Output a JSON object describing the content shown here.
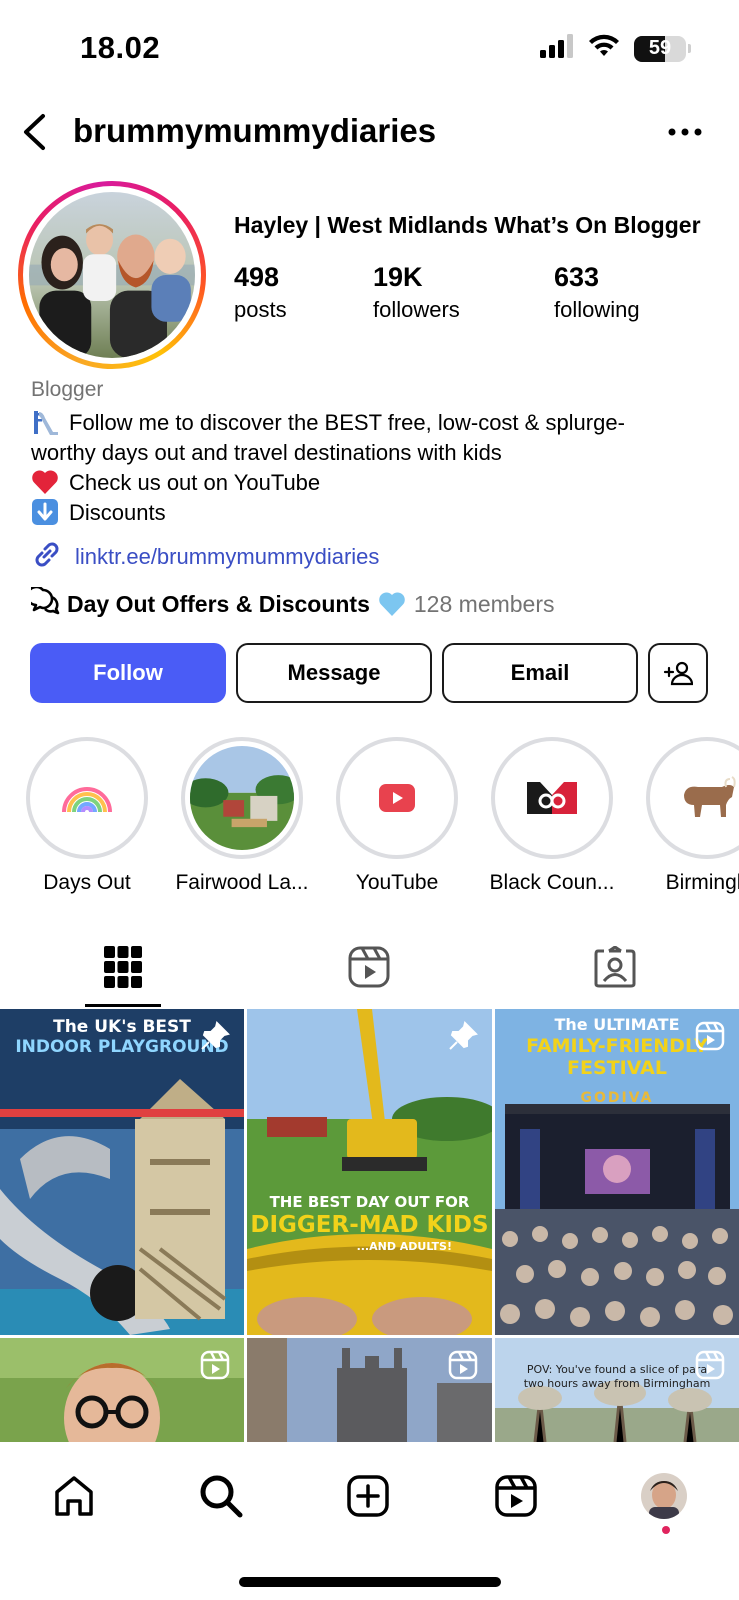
{
  "status_bar": {
    "time": "18.02",
    "battery": "59",
    "battery_level": 0.59
  },
  "profile": {
    "username": "brummymummydiaries",
    "display_name": "Hayley | West Midlands What’s On Blogger",
    "stats": [
      {
        "value": "498",
        "label": "posts"
      },
      {
        "value": "19K",
        "label": "followers"
      },
      {
        "value": "633",
        "label": "following"
      }
    ],
    "category": "Blogger",
    "bio": {
      "line1": "Follow me to discover the BEST free, low-cost & splurge-",
      "line1b": "worthy days out and travel destinations with kids",
      "line2": "Check us out on YouTube",
      "line3": "Discounts",
      "line3_emoji": "⬇️"
    },
    "link": "linktr.ee/brummymummydiaries",
    "community": {
      "name": "Day Out Offers & Discounts",
      "members": "128 members"
    }
  },
  "actions": {
    "follow": "Follow",
    "message": "Message",
    "email": "Email"
  },
  "highlights": [
    {
      "label": "Days Out",
      "icon": "rainbow-icon"
    },
    {
      "label": "Fairwood La...",
      "icon": "park-photo"
    },
    {
      "label": "YouTube",
      "icon": "youtube-icon"
    },
    {
      "label": "Black Coun...",
      "icon": "black-country-flag-icon"
    },
    {
      "label": "Birmingh",
      "icon": "bull-icon"
    }
  ],
  "tabs": [
    {
      "name": "posts-grid",
      "icon": "grid-icon",
      "active": true
    },
    {
      "name": "reels",
      "icon": "reels-icon",
      "active": false
    },
    {
      "name": "tagged",
      "icon": "tagged-icon",
      "active": false
    }
  ],
  "posts": [
    {
      "caption_1": "The UK's BEST",
      "caption_2": "INDOOR PLAYGROUND",
      "badge": "pin-icon"
    },
    {
      "caption_1": "THE BEST DAY OUT FOR",
      "caption_2": "DIGGER-MAD KIDS",
      "caption_3": "...AND ADULTS!",
      "badge": "pin-icon"
    },
    {
      "caption_1": "The ULTIMATE",
      "caption_2": "FAMILY-FRIENDLY",
      "caption_3": "FESTIVAL",
      "stage_sign": "GODIVA",
      "badge": "reel-icon"
    },
    {
      "badge": "reel-icon"
    },
    {
      "badge": "reel-icon"
    },
    {
      "caption_1": "POV: You've found a slice of para",
      "caption_2": "two hours away from Birmingham",
      "badge": "reel-icon"
    }
  ],
  "colors": {
    "follow_blue": "#4a5cf6",
    "link_blue": "#3a4ec4",
    "muted": "#737373",
    "notification_dot": "#e0245e"
  }
}
